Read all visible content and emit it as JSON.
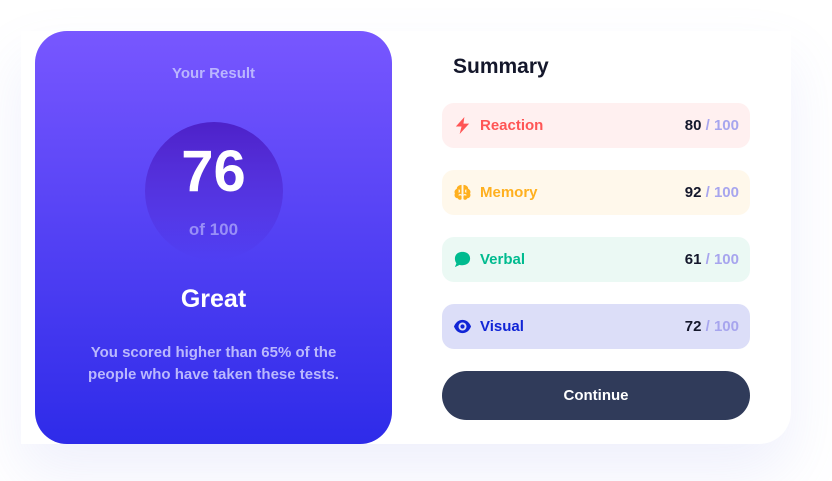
{
  "result": {
    "title": "Your Result",
    "score": "76",
    "of_label": "of 100",
    "grade": "Great",
    "description": "You scored higher than 65% of the people who have taken these tests."
  },
  "summary": {
    "title": "Summary",
    "items": [
      {
        "label": "Reaction",
        "score": "80",
        "max": "/ 100",
        "icon": "lightning-icon",
        "color": "#ff5555",
        "bg": "#fff0f0"
      },
      {
        "label": "Memory",
        "score": "92",
        "max": "/ 100",
        "icon": "brain-icon",
        "color": "#ffb01f",
        "bg": "#fff8eb"
      },
      {
        "label": "Verbal",
        "score": "61",
        "max": "/ 100",
        "icon": "chat-bubble-icon",
        "color": "#00bb8f",
        "bg": "#ebf9f4"
      },
      {
        "label": "Visual",
        "score": "72",
        "max": "/ 100",
        "icon": "eye-icon",
        "color": "#1125d6",
        "bg": "#dcdef8"
      }
    ],
    "continue_label": "Continue"
  },
  "colors": {
    "gradient_top": "#7857ff",
    "gradient_bottom": "#2e2be9",
    "button_bg": "#303b5a"
  }
}
